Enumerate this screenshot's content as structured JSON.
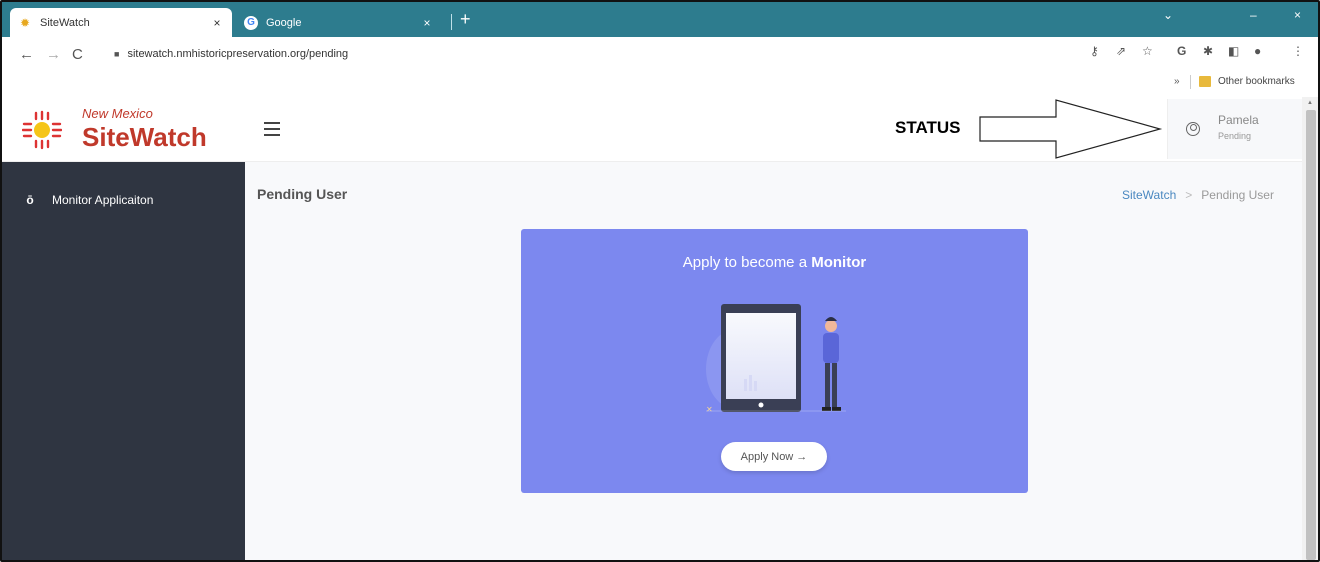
{
  "browser": {
    "tabs": [
      {
        "title": "SiteWatch",
        "favicon": "sun-favicon",
        "close": "×"
      },
      {
        "title": "Google",
        "favicon": "google-favicon",
        "close": "×"
      }
    ],
    "new_tab": "+",
    "window_controls": {
      "dropdown": "⌄",
      "minimize": "–",
      "close": "×"
    },
    "url": "sitewatch.nmhistoricpreservation.org/pending",
    "bookmarks": {
      "more": "»",
      "other": "Other bookmarks"
    }
  },
  "app": {
    "logo_subtitle": "New Mexico",
    "logo_title": "SiteWatch",
    "status_label": "STATUS",
    "user": {
      "name": "Pamela",
      "status": "Pending"
    }
  },
  "sidebar": {
    "items": [
      {
        "label": "Monitor Applicaiton",
        "icon": "hourglass-icon"
      }
    ]
  },
  "page": {
    "title": "Pending User",
    "breadcrumb": {
      "root": "SiteWatch",
      "separator": ">",
      "current": "Pending User"
    }
  },
  "card": {
    "title_prefix": "Apply to become a ",
    "title_bold": "Monitor",
    "button_label": "Apply Now →"
  },
  "colors": {
    "tab_strip": "#2d7c8e",
    "sidebar": "#2f3541",
    "card": "#7c88ef",
    "brand": "#c0392b"
  }
}
